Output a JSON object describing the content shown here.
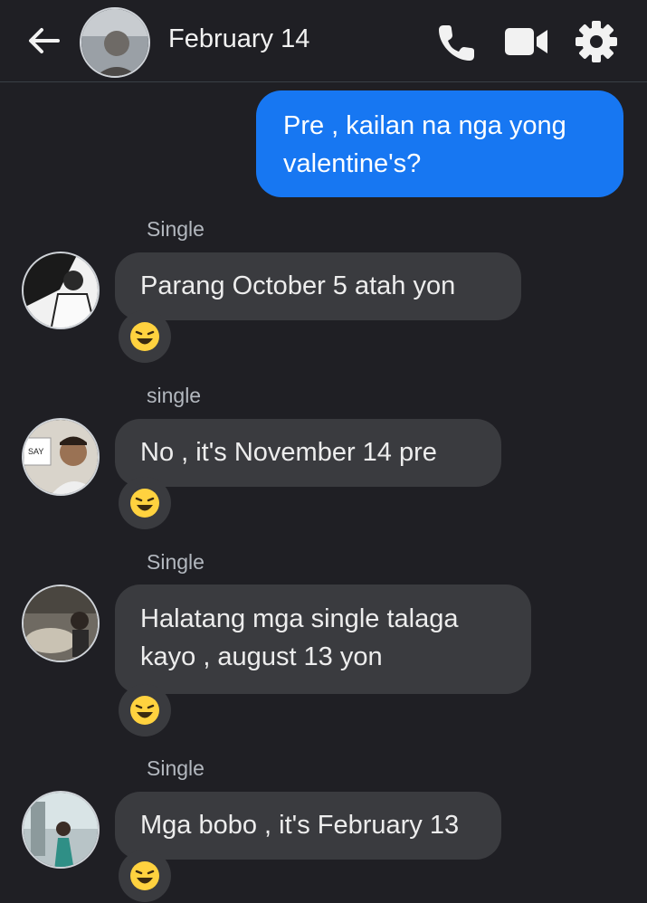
{
  "header": {
    "title": "February 14",
    "back_icon": "back-arrow-icon",
    "call_icon": "phone-icon",
    "video_icon": "video-camera-icon",
    "settings_icon": "gear-icon"
  },
  "messages": {
    "outgoing": {
      "text_line1": "Pre , kailan na nga yong",
      "text_line2": "valentine's?"
    },
    "m1": {
      "sender": "Single",
      "text": "Parang October 5 atah yon",
      "reaction": "laughing-emoji"
    },
    "m2": {
      "sender": "single",
      "text": "No , it's November 14 pre",
      "reaction": "laughing-emoji"
    },
    "m3": {
      "sender": "Single",
      "text_line1": "Halatang mga single talaga",
      "text_line2": "kayo , august 13 yon",
      "reaction": "laughing-emoji"
    },
    "m4": {
      "sender": "Single",
      "text": "Mga bobo , it's February 13",
      "reaction": "laughing-emoji"
    }
  },
  "colors": {
    "background": "#1f1f24",
    "outgoing_bubble": "#1777f2",
    "incoming_bubble": "#3a3b3f",
    "sender_text": "#b3b8bf"
  }
}
